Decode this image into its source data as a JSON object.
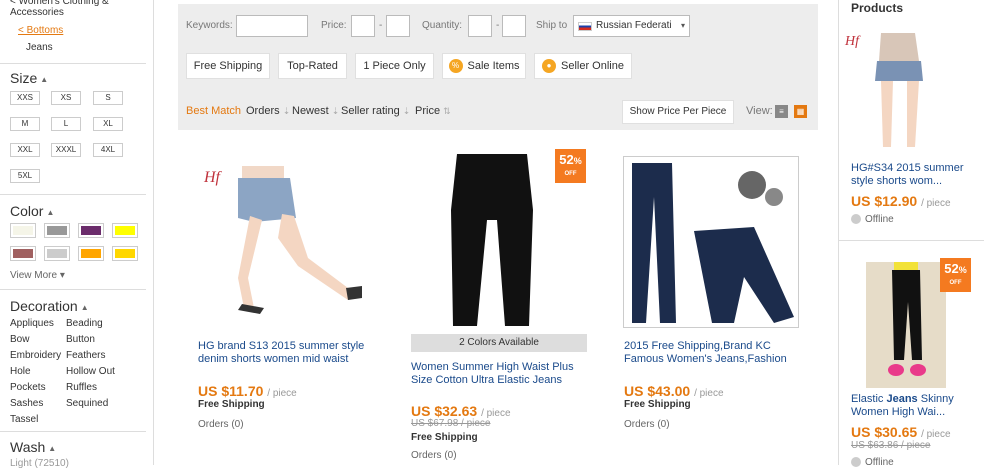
{
  "sidebar": {
    "breadcrumb_top": "< Women's Clothing & Accessories",
    "breadcrumb_bottoms": "< Bottoms",
    "breadcrumb_jeans": "Jeans",
    "size_title": "Size",
    "sizes": [
      "XXS",
      "XS",
      "S",
      "M",
      "L",
      "XL",
      "XXL",
      "XXXL",
      "4XL",
      "5XL"
    ],
    "color_title": "Color",
    "colors": [
      "#f5f5e8",
      "#999999",
      "#6b2c6b",
      "#ffff00",
      "#a06060",
      "#cccccc",
      "#ffa500",
      "#ffd700"
    ],
    "view_more": "View More ▾",
    "decoration_title": "Decoration",
    "decorations_left": [
      "Appliques",
      "Bow",
      "Embroidery",
      "Hole",
      "Pockets",
      "Sashes",
      "Tassel"
    ],
    "decorations_right": [
      "Beading",
      "Button",
      "Feathers",
      "Hollow Out",
      "Ruffles",
      "Sequined"
    ],
    "wash_title": "Wash",
    "wash_item": "Light (72510)"
  },
  "filter": {
    "keywords_label": "Keywords:",
    "price_label": "Price:",
    "dash": "-",
    "quantity_label": "Quantity:",
    "ship_to_label": "Ship to",
    "ship_to_value": "Russian Federati",
    "free_shipping": "Free Shipping",
    "top_rated": "Top-Rated",
    "one_piece": "1 Piece Only",
    "sale_items": "Sale Items",
    "seller_online": "Seller Online",
    "sort_best": "Best Match",
    "sort_orders": "Orders",
    "sort_newest": "Newest",
    "sort_seller": "Seller rating",
    "sort_price": "Price",
    "show_price": "Show Price Per Piece",
    "view_label": "View:"
  },
  "products": [
    {
      "title": "HG brand S13 2015 summer style denim shorts women mid waist",
      "price": "US $11.70",
      "unit": "/ piece",
      "shipping": "Free Shipping",
      "orders": "Orders (0)"
    },
    {
      "title": "Women Summer High Waist Plus Size Cotton Ultra Elastic Jeans",
      "price": "US $32.63",
      "unit": "/ piece",
      "old_price": "US $67.98 / piece",
      "shipping": "Free Shipping",
      "orders": "Orders (0)",
      "badge": "52",
      "badge_unit": "%",
      "badge_off": "OFF",
      "colors_available": "2 Colors Available"
    },
    {
      "title": "2015 Free Shipping,Brand KC Famous Women's Jeans,Fashion",
      "price": "US $43.00",
      "unit": "/ piece",
      "shipping": "Free Shipping",
      "orders": "Orders (0)"
    }
  ],
  "right": {
    "title": "Products",
    "item1_title": "HG#S34 2015 summer style shorts wom...",
    "item1_price": "US $12.90",
    "item1_unit": "/ piece",
    "item1_status": "Offline",
    "item2_title_pre": "Elastic ",
    "item2_title_bold": "Jeans",
    "item2_title_post": " Skinny Women High Wai...",
    "item2_price": "US $30.65",
    "item2_unit": "/ piece",
    "item2_old": "US $63.86 / piece",
    "item2_status": "Offline",
    "item2_badge": "52",
    "item2_badge_unit": "%",
    "item2_badge_off": "OFF"
  },
  "colors": {
    "accent": "#e47911",
    "link": "#1a4a8b",
    "badge": "#f47a20"
  }
}
